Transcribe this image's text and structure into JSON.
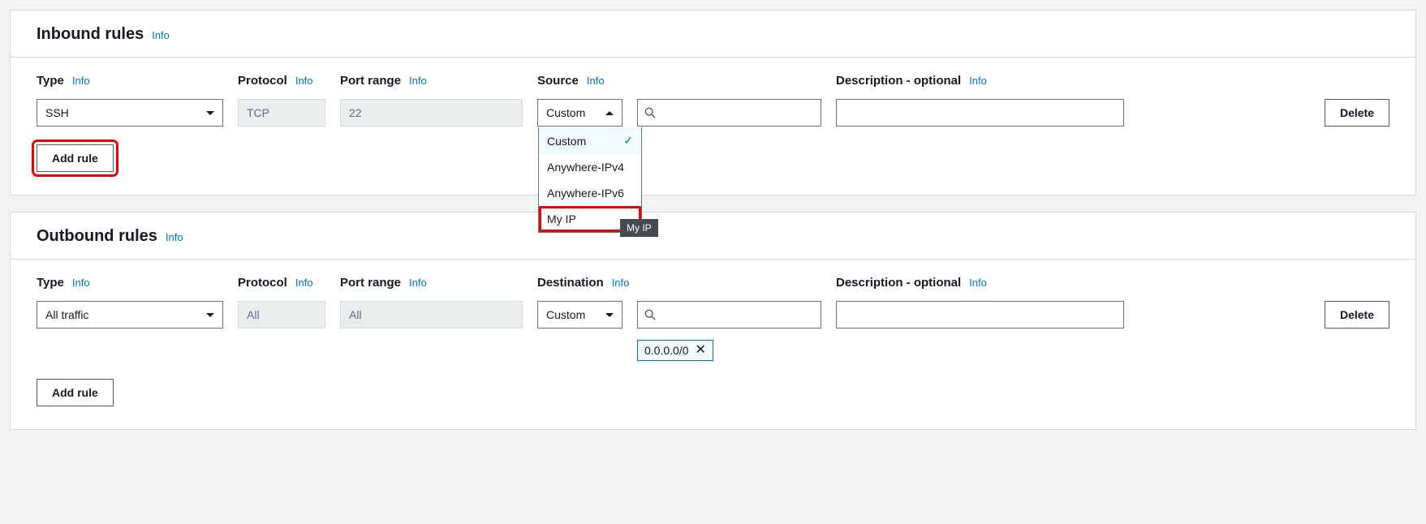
{
  "common": {
    "info": "Info",
    "delete": "Delete",
    "add_rule": "Add rule"
  },
  "labels": {
    "type": "Type",
    "protocol": "Protocol",
    "port_range": "Port range",
    "source": "Source",
    "destination": "Destination",
    "description_optional": "Description - optional"
  },
  "inbound": {
    "title": "Inbound rules",
    "row": {
      "type": "SSH",
      "protocol": "TCP",
      "port": "22",
      "source_mode": "Custom",
      "description": ""
    },
    "source_dropdown": {
      "options": [
        "Custom",
        "Anywhere-IPv4",
        "Anywhere-IPv6",
        "My IP"
      ],
      "selected": "Custom",
      "highlighted": "My IP",
      "tooltip": "My IP"
    }
  },
  "outbound": {
    "title": "Outbound rules",
    "row": {
      "type": "All traffic",
      "protocol": "All",
      "port": "All",
      "dest_mode": "Custom",
      "description": "",
      "dest_chips": [
        "0.0.0.0/0"
      ]
    }
  }
}
